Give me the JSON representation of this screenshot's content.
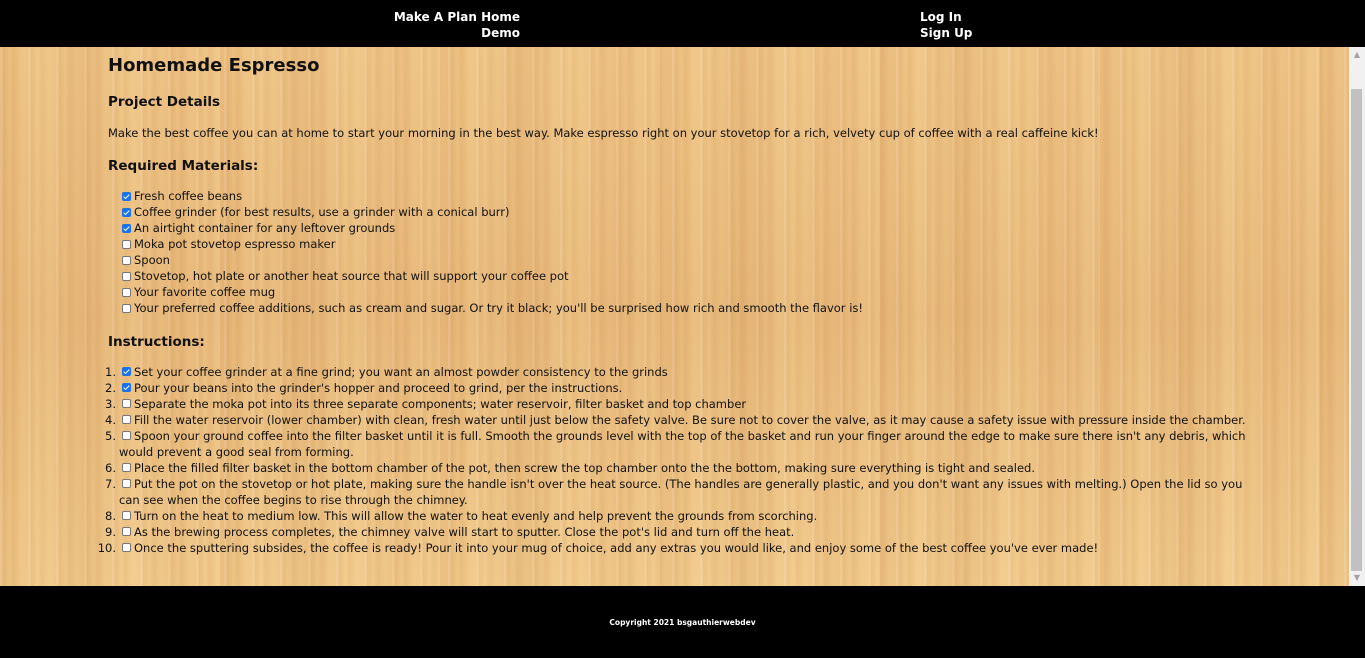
{
  "nav": {
    "home": "Make A Plan Home",
    "demo": "Demo",
    "login": "Log In",
    "signup": "Sign Up"
  },
  "page": {
    "title": "Homemade Espresso",
    "details_heading": "Project Details",
    "details_text": "Make the best coffee you can at home to start your morning in the best way. Make espresso right on your stovetop for a rich, velvety cup of coffee with a real caffeine kick!",
    "materials_heading": "Required Materials:",
    "materials": [
      {
        "label": "Fresh coffee beans",
        "checked": true
      },
      {
        "label": "Coffee grinder (for best results, use a grinder with a conical burr)",
        "checked": true
      },
      {
        "label": "An airtight container for any leftover grounds",
        "checked": true
      },
      {
        "label": "Moka pot stovetop espresso maker",
        "checked": false
      },
      {
        "label": "Spoon",
        "checked": false
      },
      {
        "label": "Stovetop, hot plate or another heat source that will support your coffee pot",
        "checked": false
      },
      {
        "label": "Your favorite coffee mug",
        "checked": false
      },
      {
        "label": "Your preferred coffee additions, such as cream and sugar. Or try it black; you'll be surprised how rich and smooth the flavor is!",
        "checked": false
      }
    ],
    "instructions_heading": "Instructions:",
    "instructions": [
      {
        "num": "1.",
        "text": "Set your coffee grinder at a fine grind; you want an almost powder consistency to the grinds",
        "checked": true
      },
      {
        "num": "2.",
        "text": "Pour your beans into the grinder's hopper and proceed to grind, per the instructions.",
        "checked": true
      },
      {
        "num": "3.",
        "text": "Separate the moka pot into its three separate components; water reservoir, filter basket and top chamber",
        "checked": false
      },
      {
        "num": "4.",
        "text": "Fill the water reservoir (lower chamber) with clean, fresh water until just below the safety valve. Be sure not to cover the valve, as it may cause a safety issue with pressure inside the chamber.",
        "checked": false
      },
      {
        "num": "5.",
        "text": "Spoon your ground coffee into the filter basket until it is full. Smooth the grounds level with the top of the basket and run your finger around the edge to make sure there isn't any debris, which would prevent a good seal from forming.",
        "checked": false
      },
      {
        "num": "6.",
        "text": "Place the filled filter basket in the bottom chamber of the pot, then screw the top chamber onto the the bottom, making sure everything is tight and sealed.",
        "checked": false
      },
      {
        "num": "7.",
        "text": "Put the pot on the stovetop or hot plate, making sure the handle isn't over the heat source. (The handles are generally plastic, and you don't want any issues with melting.) Open the lid so you can see when the coffee begins to rise through the chimney.",
        "checked": false
      },
      {
        "num": "8.",
        "text": "Turn on the heat to medium low. This will allow the water to heat evenly and help prevent the grounds from scorching.",
        "checked": false
      },
      {
        "num": "9.",
        "text": "As the brewing process completes, the chimney valve will start to sputter. Close the pot's lid and turn off the heat.",
        "checked": false
      },
      {
        "num": "10.",
        "text": "Once the sputtering subsides, the coffee is ready! Pour it into your mug of choice, add any extras you would like, and enjoy some of the best coffee you've ever made!",
        "checked": false
      }
    ]
  },
  "footer": {
    "copyright": "Copyright 2021 bsgauthierwebdev"
  }
}
